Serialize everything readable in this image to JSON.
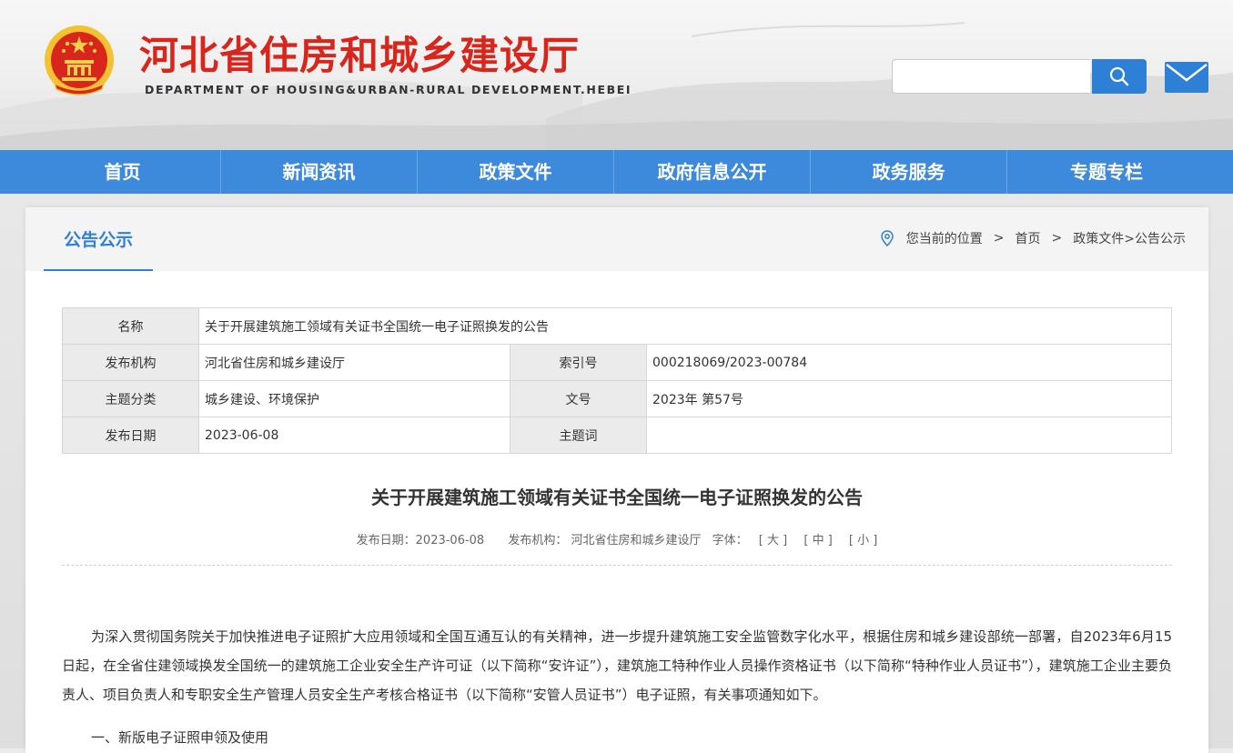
{
  "header": {
    "title": "河北省住房和城乡建设厅",
    "subtitle": "DEPARTMENT OF HOUSING&URBAN-RURAL DEVELOPMENT.HEBEI",
    "search_placeholder": "",
    "colors": {
      "brand_red": "#d9261c",
      "nav_blue": "#3d89dc",
      "accent_blue": "#2e7fd6"
    }
  },
  "nav": {
    "items": [
      "首页",
      "新闻资讯",
      "政策文件",
      "政府信息公开",
      "政务服务",
      "专题专栏"
    ]
  },
  "section": {
    "title": "公告公示",
    "breadcrumb": {
      "prefix": "您当前的位置",
      "sep": ">",
      "home": "首页",
      "path": "政策文件>公告公示"
    }
  },
  "meta": {
    "name_label": "名称",
    "name_value": "关于开展建筑施工领域有关证书全国统一电子证照换发的公告",
    "publisher_label": "发布机构",
    "publisher_value": "河北省住房和城乡建设厅",
    "index_label": "索引号",
    "index_value": "000218069/2023-00784",
    "topic_label": "主题分类",
    "topic_value": "城乡建设、环境保护",
    "docno_label": "文号",
    "docno_value": "2023年 第57号",
    "date_label": "发布日期",
    "date_value": "2023-06-08",
    "keyword_label": "主题词",
    "keyword_value": ""
  },
  "article": {
    "title": "关于开展建筑施工领域有关证书全国统一电子证照换发的公告",
    "info_date": "发布日期：2023-06-08",
    "info_org": "发布机构：  河北省住房和城乡建设厅",
    "font_label": "字体：",
    "font_large": "[ 大 ]",
    "font_medium": "[ 中 ]",
    "font_small": "[ 小 ]",
    "paragraph1": "为深入贯彻国务院关于加快推进电子证照扩大应用领域和全国互通互认的有关精神，进一步提升建筑施工安全监管数字化水平，根据住房和城乡建设部统一部署，自2023年6月15日起，在全省住建领域换发全国统一的建筑施工企业安全生产许可证（以下简称“安许证”），建筑施工特种作业人员操作资格证书（以下简称“特种作业人员证书”），建筑施工企业主要负责人、项目负责人和专职安全生产管理人员安全生产考核合格证书（以下简称“安管人员证书”）电子证照，有关事项通知如下。",
    "heading1": "一、新版电子证照申领及使用"
  }
}
